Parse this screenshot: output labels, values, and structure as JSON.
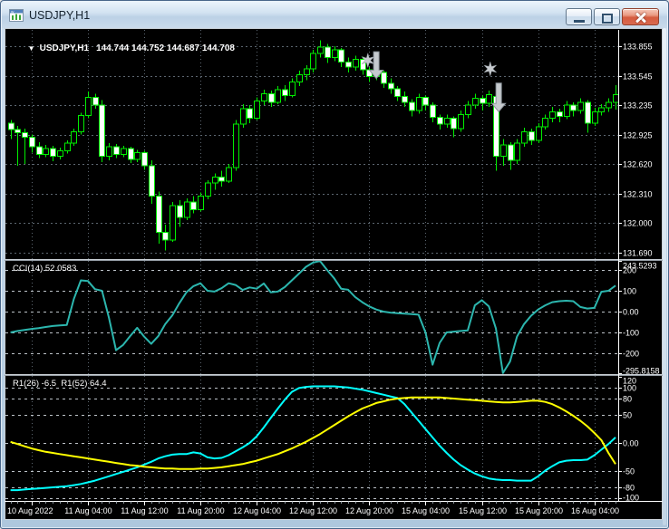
{
  "window": {
    "title": "USDJPY,H1",
    "minimize_label": "Minimize",
    "maximize_label": "Maximize",
    "close_label": "Close"
  },
  "colors": {
    "chart_background": "#000000",
    "grid": "#5C6670",
    "level_line": "#BCC2C8",
    "candle_outline": "#00EE00",
    "bull_fill": "#000000",
    "bear_fill": "#FFFFFF",
    "cci_line": "#2CB6AE",
    "r1_fast_line": "#00FFFF",
    "r1_slow_line": "#FFFF00",
    "object_silver": "#C6CACE",
    "axis_text": "#FFFFFF",
    "divider": "#9AA2AA",
    "separator_white": "#FFFFFF"
  },
  "main": {
    "dropdown_glyph": "▼",
    "symbol": "USDJPY,H1",
    "ohlc": "144.744 144.752 144.687 144.708"
  },
  "cci": {
    "label": "CCI(14) 52.0583"
  },
  "r1": {
    "label": "R1(26) -6.5  R1(52) 64.4"
  },
  "chart_data": [
    {
      "type": "candlestick",
      "title": "USDJPY,H1",
      "ylim": [
        131.62,
        134.03
      ],
      "y_ticks": [
        133.855,
        133.545,
        133.235,
        132.925,
        132.62,
        132.31,
        132.0,
        131.69
      ],
      "x_tick_labels": [
        "10 Aug 2022",
        "11 Aug 04:00",
        "11 Aug 12:00",
        "11 Aug 20:00",
        "12 Aug 04:00",
        "12 Aug 12:00",
        "12 Aug 20:00",
        "15 Aug 04:00",
        "15 Aug 12:00",
        "15 Aug 20:00",
        "16 Aug 04:00"
      ],
      "x_tick_first_bar": 3,
      "x_tick_every": 8,
      "ohlc": [
        [
          133.05,
          133.08,
          132.88,
          132.98
        ],
        [
          132.98,
          133.02,
          132.6,
          132.95
        ],
        [
          132.95,
          132.99,
          132.62,
          132.9
        ],
        [
          132.9,
          132.93,
          132.74,
          132.8
        ],
        [
          132.8,
          132.85,
          132.68,
          132.72
        ],
        [
          132.72,
          132.82,
          132.69,
          132.78
        ],
        [
          132.78,
          132.81,
          132.65,
          132.7
        ],
        [
          132.7,
          132.79,
          132.67,
          132.76
        ],
        [
          132.76,
          132.87,
          132.73,
          132.84
        ],
        [
          132.84,
          132.99,
          132.81,
          132.96
        ],
        [
          132.96,
          133.16,
          132.93,
          133.13
        ],
        [
          133.13,
          133.38,
          133.1,
          133.32
        ],
        [
          133.32,
          133.36,
          133.2,
          133.24
        ],
        [
          133.24,
          133.29,
          132.64,
          132.7
        ],
        [
          132.7,
          132.84,
          132.66,
          132.8
        ],
        [
          132.8,
          132.83,
          132.68,
          132.72
        ],
        [
          132.72,
          132.81,
          132.69,
          132.78
        ],
        [
          132.78,
          132.8,
          132.63,
          132.67
        ],
        [
          132.67,
          132.77,
          132.64,
          132.74
        ],
        [
          132.74,
          132.76,
          132.56,
          132.6
        ],
        [
          132.6,
          132.66,
          132.2,
          132.28
        ],
        [
          132.28,
          132.33,
          131.78,
          131.9
        ],
        [
          131.9,
          131.98,
          131.71,
          131.82
        ],
        [
          131.82,
          132.22,
          131.8,
          132.18
        ],
        [
          132.18,
          132.24,
          131.96,
          132.06
        ],
        [
          132.06,
          132.26,
          132.03,
          132.22
        ],
        [
          132.22,
          132.28,
          132.1,
          132.14
        ],
        [
          132.14,
          132.32,
          132.12,
          132.28
        ],
        [
          132.28,
          132.45,
          132.25,
          132.42
        ],
        [
          132.42,
          132.52,
          132.35,
          132.48
        ],
        [
          132.48,
          132.55,
          132.38,
          132.44
        ],
        [
          132.44,
          132.62,
          132.42,
          132.58
        ],
        [
          132.58,
          133.08,
          132.55,
          133.04
        ],
        [
          133.04,
          133.25,
          133.0,
          133.2
        ],
        [
          133.2,
          133.24,
          133.05,
          133.1
        ],
        [
          133.1,
          133.32,
          133.08,
          133.28
        ],
        [
          133.28,
          133.4,
          133.24,
          133.36
        ],
        [
          133.36,
          133.39,
          133.22,
          133.27
        ],
        [
          133.27,
          133.44,
          133.25,
          133.4
        ],
        [
          133.4,
          133.45,
          133.28,
          133.34
        ],
        [
          133.34,
          133.52,
          133.32,
          133.48
        ],
        [
          133.48,
          133.6,
          133.44,
          133.56
        ],
        [
          133.56,
          133.66,
          133.5,
          133.62
        ],
        [
          133.62,
          133.82,
          133.58,
          133.78
        ],
        [
          133.78,
          133.92,
          133.74,
          133.85
        ],
        [
          133.85,
          133.88,
          133.68,
          133.74
        ],
        [
          133.74,
          133.86,
          133.7,
          133.82
        ],
        [
          133.82,
          133.84,
          133.64,
          133.69
        ],
        [
          133.69,
          133.74,
          133.58,
          133.64
        ],
        [
          133.64,
          133.76,
          133.6,
          133.72
        ],
        [
          133.72,
          133.75,
          133.56,
          133.61
        ],
        [
          133.61,
          133.64,
          133.48,
          133.54
        ],
        [
          133.54,
          133.62,
          133.5,
          133.58
        ],
        [
          133.58,
          133.6,
          133.42,
          133.47
        ],
        [
          133.47,
          133.52,
          133.36,
          133.41
        ],
        [
          133.41,
          133.44,
          133.28,
          133.33
        ],
        [
          133.33,
          133.38,
          133.22,
          133.27
        ],
        [
          133.27,
          133.3,
          133.12,
          133.18
        ],
        [
          133.18,
          133.36,
          133.15,
          133.32
        ],
        [
          133.32,
          133.34,
          133.18,
          133.24
        ],
        [
          133.24,
          133.27,
          133.06,
          133.11
        ],
        [
          133.11,
          133.14,
          132.98,
          133.04
        ],
        [
          133.04,
          133.14,
          133.0,
          133.1
        ],
        [
          133.1,
          133.12,
          132.9,
          132.99
        ],
        [
          132.99,
          133.18,
          132.96,
          133.14
        ],
        [
          133.14,
          133.28,
          133.1,
          133.24
        ],
        [
          133.24,
          133.36,
          133.2,
          133.31
        ],
        [
          133.31,
          133.34,
          133.18,
          133.26
        ],
        [
          133.26,
          133.39,
          133.22,
          133.35
        ],
        [
          133.33,
          133.38,
          132.55,
          132.7
        ],
        [
          132.7,
          132.88,
          132.6,
          132.82
        ],
        [
          132.82,
          132.85,
          132.56,
          132.66
        ],
        [
          132.66,
          132.88,
          132.62,
          132.84
        ],
        [
          132.84,
          133.0,
          132.8,
          132.96
        ],
        [
          132.96,
          132.99,
          132.82,
          132.87
        ],
        [
          132.87,
          133.05,
          132.84,
          133.01
        ],
        [
          133.01,
          133.14,
          132.98,
          133.1
        ],
        [
          133.1,
          133.22,
          133.06,
          133.17
        ],
        [
          133.17,
          133.2,
          133.06,
          133.12
        ],
        [
          133.12,
          133.28,
          133.09,
          133.24
        ],
        [
          133.24,
          133.27,
          133.12,
          133.18
        ],
        [
          133.18,
          133.31,
          133.15,
          133.27
        ],
        [
          133.27,
          133.29,
          132.95,
          133.05
        ],
        [
          133.05,
          133.21,
          133.02,
          133.17
        ],
        [
          133.17,
          133.25,
          133.13,
          133.21
        ],
        [
          133.21,
          133.31,
          133.17,
          133.27
        ],
        [
          133.27,
          133.45,
          133.19,
          133.35
        ]
      ]
    },
    {
      "type": "line",
      "name": "CCI(14)",
      "current_value": 52.0583,
      "ylim": [
        -300,
        243.53
      ],
      "y_ticks": [
        {
          "t": "243.5293",
          "v": 243.5293
        },
        {
          "t": "200",
          "v": 200
        },
        {
          "t": "100",
          "v": 100
        },
        {
          "t": "0.00",
          "v": 0
        },
        {
          "t": "-100",
          "v": -100
        },
        {
          "t": "-200",
          "v": -200
        },
        {
          "t": "-295.8158",
          "v": -295.8158
        }
      ],
      "levels": [
        200,
        100,
        0,
        -100,
        -200
      ],
      "values": [
        -100,
        -93,
        -88,
        -83,
        -79,
        -74,
        -69,
        -66,
        -64,
        60,
        150,
        147,
        108,
        100,
        -30,
        -185,
        -160,
        -118,
        -78,
        -120,
        -155,
        -118,
        -60,
        -18,
        40,
        92,
        122,
        136,
        100,
        96,
        112,
        136,
        128,
        104,
        116,
        110,
        135,
        92,
        96,
        118,
        150,
        182,
        215,
        235,
        243,
        200,
        160,
        110,
        105,
        70,
        45,
        25,
        10,
        0,
        -5,
        -8,
        -10,
        -12,
        -15,
        -100,
        -255,
        -150,
        -100,
        -96,
        -93,
        -90,
        30,
        55,
        25,
        -80,
        -295,
        -240,
        -120,
        -60,
        -20,
        10,
        30,
        45,
        50,
        52,
        50,
        22,
        15,
        18,
        95,
        100,
        125
      ]
    },
    {
      "type": "line",
      "name": "R1",
      "ylim": [
        -104.5,
        120.8
      ],
      "y_ticks": [
        {
          "t": "120",
          "v": 120
        },
        {
          "t": "100",
          "v": 100
        },
        {
          "t": "80",
          "v": 80
        },
        {
          "t": "50",
          "v": 50
        },
        {
          "t": "0.00",
          "v": 0
        },
        {
          "t": "-50",
          "v": -50
        },
        {
          "t": "-80",
          "v": -80
        },
        {
          "t": "-100",
          "v": -100
        }
      ],
      "levels": [
        100,
        80,
        50,
        0,
        -50,
        -80,
        -100
      ],
      "series": [
        {
          "name": "R1(26)",
          "current_value": -6.5,
          "color_key": "r1_fast_line",
          "values": [
            -85,
            -85,
            -84,
            -83,
            -82,
            -81,
            -80,
            -79,
            -78,
            -76,
            -74,
            -71,
            -68,
            -64,
            -60,
            -56,
            -52,
            -48,
            -44,
            -39,
            -34,
            -28,
            -24,
            -21,
            -20,
            -20,
            -17,
            -19,
            -26,
            -28,
            -27,
            -22,
            -15,
            -8,
            0,
            12,
            28,
            45,
            62,
            78,
            92,
            99,
            101,
            102,
            102,
            102,
            102,
            101,
            100,
            98,
            96,
            93,
            90,
            87,
            84,
            81,
            70,
            55,
            40,
            25,
            10,
            -5,
            -18,
            -30,
            -40,
            -48,
            -55,
            -60,
            -64,
            -66,
            -67,
            -67,
            -68,
            -68,
            -68,
            -60,
            -50,
            -42,
            -35,
            -32,
            -31,
            -31,
            -30,
            -22,
            -12,
            -2,
            10
          ]
        },
        {
          "name": "R1(52)",
          "current_value": 64.4,
          "color_key": "r1_slow_line",
          "values": [
            2,
            -2,
            -6,
            -10,
            -13,
            -16,
            -18,
            -20,
            -22,
            -24,
            -26,
            -28,
            -30,
            -32,
            -34,
            -36,
            -38,
            -40,
            -41,
            -43,
            -44,
            -45,
            -46,
            -46,
            -47,
            -47,
            -47,
            -46,
            -46,
            -45,
            -44,
            -42,
            -40,
            -38,
            -35,
            -32,
            -28,
            -24,
            -20,
            -15,
            -10,
            -4,
            2,
            9,
            16,
            24,
            32,
            40,
            48,
            55,
            62,
            67,
            72,
            75,
            78,
            80,
            81,
            82,
            82,
            82,
            82,
            82,
            81,
            80,
            79,
            78,
            77,
            76,
            75,
            74,
            73,
            73,
            74,
            75,
            76,
            76,
            74,
            70,
            64,
            57,
            49,
            40,
            30,
            18,
            5,
            -18,
            -38
          ]
        }
      ]
    }
  ],
  "chart_objects": {
    "arrows": [
      {
        "type": "arrow-down",
        "bar": 52,
        "top_price": 133.8,
        "tip_price": 133.52
      },
      {
        "type": "arrow-down",
        "bar": 69.4,
        "top_price": 133.47,
        "tip_price": 133.17
      }
    ],
    "stars": [
      {
        "type": "star",
        "bar": 50.8,
        "price": 133.71
      },
      {
        "type": "star",
        "bar": 68.2,
        "price": 133.62
      }
    ]
  }
}
